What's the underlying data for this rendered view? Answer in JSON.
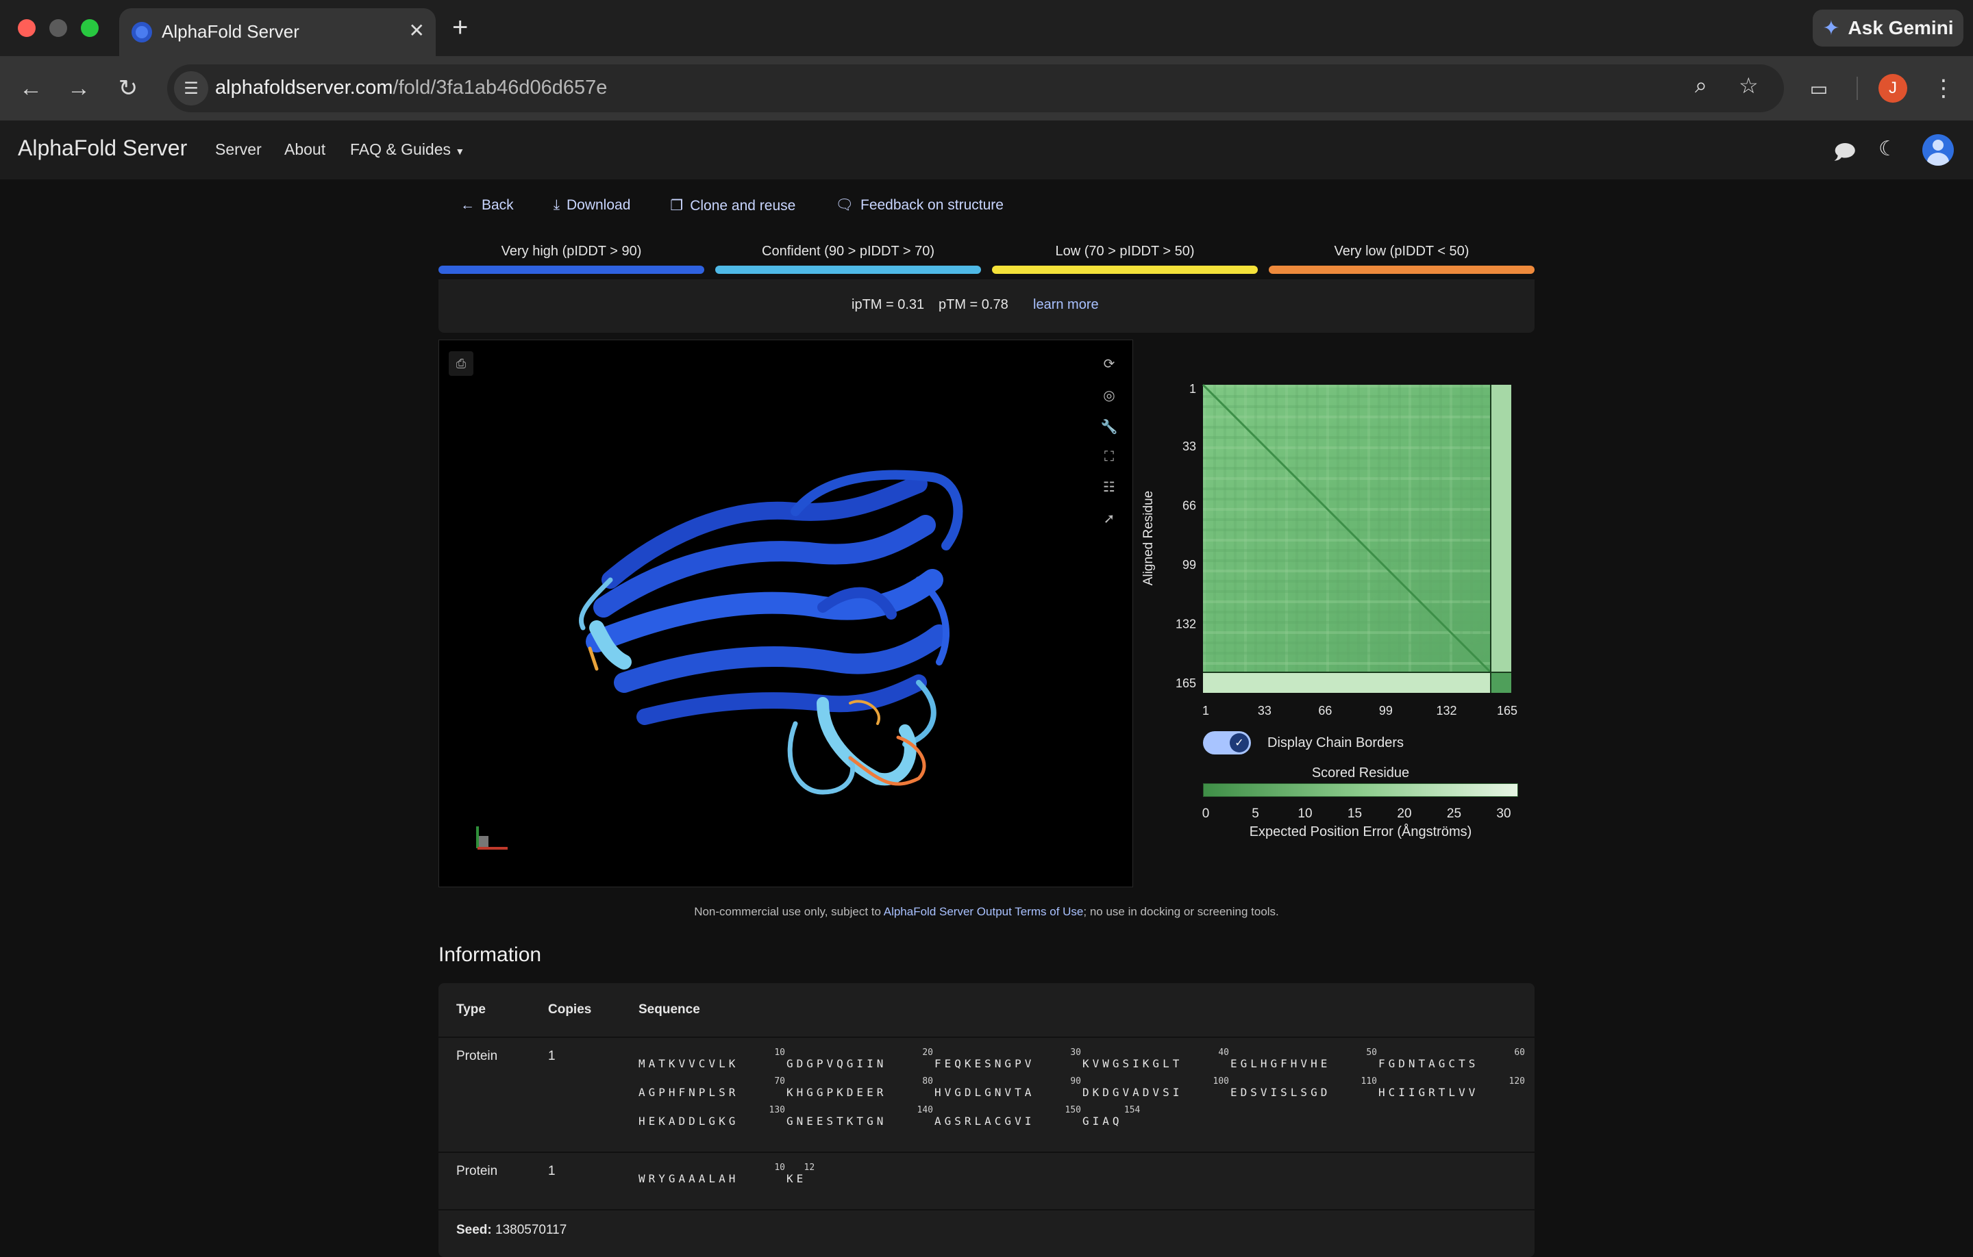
{
  "browser": {
    "tab_title": "AlphaFold Server",
    "url_host": "alphafoldserver.com",
    "url_path": "/fold/3fa1ab46d06d657e",
    "gemini_label": "Ask Gemini",
    "profile_initial": "J",
    "traffic_colors": [
      "#ff5f57",
      "#5b5b5b",
      "#28c840"
    ]
  },
  "app": {
    "brand": "AlphaFold Server",
    "nav": [
      "Server",
      "About",
      "FAQ & Guides"
    ]
  },
  "actions": {
    "back": "Back",
    "download": "Download",
    "clone": "Clone and reuse",
    "feedback": "Feedback on structure"
  },
  "plddt_legend": [
    {
      "label": "Very high (pIDDT > 90)",
      "color": "#2f62e0"
    },
    {
      "label": "Confident (90 > pIDDT > 70)",
      "color": "#4fb9e6"
    },
    {
      "label": "Low (70 > pIDDT > 50)",
      "color": "#f5e23a"
    },
    {
      "label": "Very low (pIDDT < 50)",
      "color": "#ef8a3c"
    }
  ],
  "scores": {
    "iptm": "ipTM = 0.31",
    "ptm": "pTM = 0.78",
    "learn_more": "learn more"
  },
  "pae": {
    "ylabel": "Aligned Residue",
    "ticks": [
      "1",
      "33",
      "66",
      "99",
      "132",
      "165"
    ],
    "toggle_label": "Display Chain Borders",
    "toggle_on": true,
    "xlabel": "Scored Residue",
    "colorbar_ticks": [
      "0",
      "5",
      "10",
      "15",
      "20",
      "25",
      "30"
    ],
    "colorbar_label": "Expected Position Error (Ångströms)"
  },
  "terms": {
    "prefix": "Non-commercial use only, subject to ",
    "link": "AlphaFold Server Output Terms of Use",
    "suffix": "; no use in docking or screening tools."
  },
  "information": {
    "title": "Information",
    "headers": [
      "Type",
      "Copies",
      "Sequence"
    ],
    "rows": [
      {
        "type": "Protein",
        "copies": "1",
        "lines": [
          {
            "nums": [
              "10",
              "20",
              "30",
              "40",
              "50",
              "60"
            ],
            "segs": [
              "MATKVVCVLK",
              "GDGPVQGIIN",
              "FEQKESNGPV",
              "KVWGSIKGLT",
              "EGLHGFHVHE",
              "FGDNTAGCTS"
            ]
          },
          {
            "nums": [
              "70",
              "80",
              "90",
              "100",
              "110",
              "120"
            ],
            "segs": [
              "AGPHFNPLSR",
              "KHGGPKDEER",
              "HVGDLGNVTA",
              "DKDGVADVSI",
              "EDSVISLSGD",
              "HCIIGRTLVV"
            ]
          },
          {
            "nums": [
              "130",
              "140",
              "150",
              "154"
            ],
            "segs": [
              "HEKADDLGKG",
              "GNEESTKTGN",
              "AGSRLACGVI",
              "GIAQ"
            ]
          }
        ]
      },
      {
        "type": "Protein",
        "copies": "1",
        "lines": [
          {
            "nums": [
              "10",
              "12"
            ],
            "segs": [
              "WRYGAAALAH",
              "KE"
            ]
          }
        ]
      }
    ],
    "seed_label": "Seed:",
    "seed_value": "1380570117"
  }
}
